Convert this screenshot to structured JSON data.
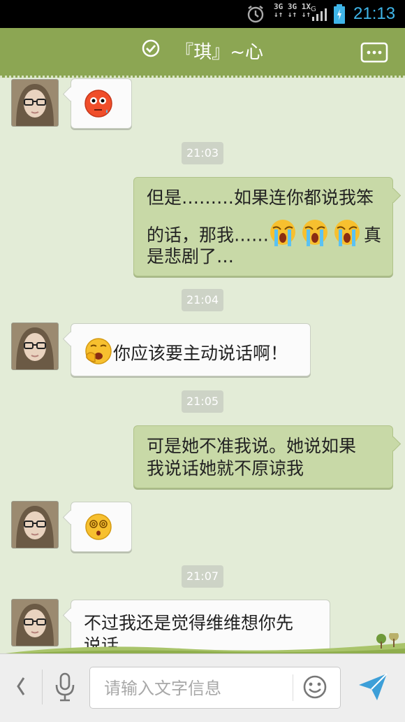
{
  "status_bar": {
    "network_top": "3G 3G 1X",
    "network_bottom": "↓↑ ↓↑ ↓↑",
    "signal_label": "G",
    "time": "21:13"
  },
  "header": {
    "title": "『琪』~心",
    "status_icon": "check-circle-icon",
    "menu_icon": "more-icon"
  },
  "messages": [
    {
      "side": "in",
      "emoji": "awkward-sweat-emoji"
    },
    {
      "timestamp": "21:03"
    },
    {
      "side": "out",
      "line1": "但是………如果连你都说我笨",
      "line2_pre": "的话，那我……",
      "line2_post": "真",
      "line3": "是悲剧了…",
      "emoji": "crying-emoji"
    },
    {
      "timestamp": "21:04"
    },
    {
      "side": "in",
      "emoji": "yawn-emoji",
      "text": "你应该要主动说话啊！"
    },
    {
      "timestamp": "21:05"
    },
    {
      "side": "out",
      "line1": "可是她不准我说。她说如果",
      "line2": "我说话她就不原谅我"
    },
    {
      "side": "in",
      "emoji": "dizzy-emoji"
    },
    {
      "timestamp": "21:07"
    },
    {
      "side": "in",
      "line1": "不过我还是觉得维维想你先",
      "line2": "说话。"
    }
  ],
  "input_bar": {
    "placeholder": "请输入文字信息",
    "value": ""
  },
  "colors": {
    "header_bg": "#8ca653",
    "outgoing_bubble": "#c8d9a7",
    "incoming_bubble": "#fbfbfb",
    "chat_bg": "#e3ecd7",
    "time_accent": "#3fb5e8",
    "send_icon": "#3d9fd8"
  }
}
